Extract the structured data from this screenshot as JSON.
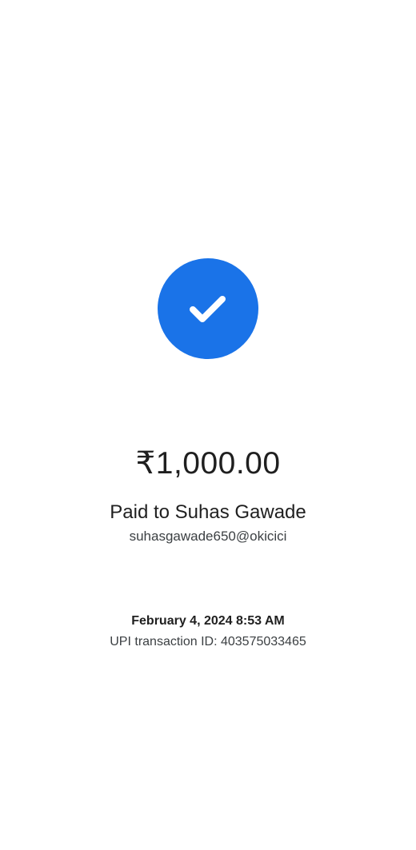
{
  "colors": {
    "accent": "#1a73e8",
    "background": "#ffffff",
    "text_primary": "#1f1f1f",
    "text_secondary": "#3c4043"
  },
  "status": {
    "icon": "check-icon"
  },
  "payment": {
    "amount": "₹1,000.00",
    "paid_to": "Paid to Suhas Gawade",
    "upi_id": "suhasgawade650@okicici",
    "datetime": "February 4, 2024 8:53 AM",
    "transaction_id": "UPI transaction ID: 403575033465"
  }
}
